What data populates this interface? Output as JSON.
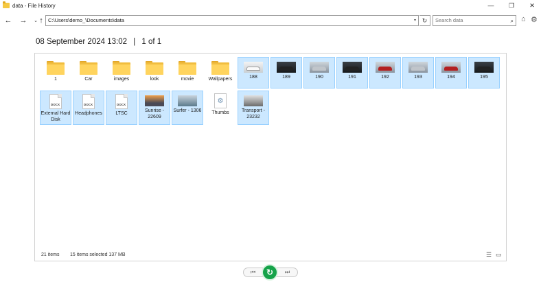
{
  "window": {
    "title": "data - File History",
    "minimize": "—",
    "maximize": "❐",
    "close": "✕"
  },
  "nav": {
    "back": "←",
    "forward": "→",
    "recent": "⌄",
    "up": "↑",
    "address": "C:\\Users\\demo_\\Documents\\data",
    "address_dropdown": "▾",
    "refresh": "↻",
    "search_placeholder": "Search data",
    "search_icon": "⌕",
    "home_icon": "⌂",
    "settings_icon": "⚙"
  },
  "heading": {
    "date": "08 September 2024 13:02",
    "separator": "|",
    "pager": "1 of 1"
  },
  "items": [
    {
      "label": "1",
      "kind": "folder",
      "selected": false
    },
    {
      "label": "Car",
      "kind": "folder",
      "selected": false
    },
    {
      "label": "images",
      "kind": "folder",
      "selected": false
    },
    {
      "label": "look",
      "kind": "folder",
      "selected": false
    },
    {
      "label": "movie",
      "kind": "folder",
      "selected": false
    },
    {
      "label": "Wallpapers",
      "kind": "folder",
      "selected": false
    },
    {
      "label": "188",
      "kind": "car-white",
      "selected": true
    },
    {
      "label": "189",
      "kind": "car-dark",
      "selected": true
    },
    {
      "label": "190",
      "kind": "car-silver",
      "selected": true
    },
    {
      "label": "191",
      "kind": "car-dark",
      "selected": true
    },
    {
      "label": "192",
      "kind": "car-red",
      "selected": true
    },
    {
      "label": "193",
      "kind": "car-silver",
      "selected": true
    },
    {
      "label": "194",
      "kind": "car-red",
      "selected": true
    },
    {
      "label": "195",
      "kind": "car-dark",
      "selected": true
    },
    {
      "label": "External Hard Disk",
      "kind": "docx",
      "selected": true
    },
    {
      "label": "Headphones",
      "kind": "docx",
      "selected": true
    },
    {
      "label": "LTSC",
      "kind": "docx",
      "selected": true
    },
    {
      "label": "Sunrise - 22609",
      "kind": "sunrise",
      "selected": true
    },
    {
      "label": "Surfer - 1306",
      "kind": "surfer",
      "selected": true
    },
    {
      "label": "Thumbs",
      "kind": "settings",
      "selected": false
    },
    {
      "label": "Transport - 23232",
      "kind": "transport",
      "selected": true
    }
  ],
  "doc_tag": "DOCX",
  "status": {
    "count": "21 items",
    "selection": "15 items selected  137 MB",
    "details_view_icon": "☰",
    "tiles_view_icon": "▭"
  },
  "controls": {
    "previous": "⏮",
    "restore": "↻",
    "next": "⏭"
  },
  "colors": {
    "selection_fill": "#cce8ff",
    "selection_border": "#99d1ff",
    "restore_green": "#16a34a",
    "folder_yellow": "#ffd45e"
  }
}
